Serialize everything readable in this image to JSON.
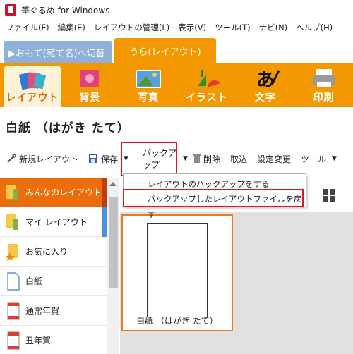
{
  "window": {
    "title": "筆ぐるめ for Windows"
  },
  "menu": [
    "ファイル(F)",
    "編集(E)",
    "レイアウトの管理(L)",
    "表示(V)",
    "ツール(T)",
    "ナビ(N)",
    "ヘルプ(H)"
  ],
  "view_tabs": {
    "front": "▶おもて(宛て名)へ切替",
    "back": "うら(レイアウト)"
  },
  "categories": [
    "レイアウト",
    "背景",
    "写真",
    "イラスト",
    "文字",
    "印刷"
  ],
  "doc_title": "白紙 （はがき たて）",
  "toolbar": {
    "new_layout": "新規レイアウト",
    "save": "保存",
    "backup": "バックアップ",
    "delete": "削除",
    "import": "取込",
    "settings_change": "設定変更",
    "tools": "ツール"
  },
  "dropdown": {
    "items": [
      "レイアウトのバックアップをする",
      "バックアップしたレイアウトファイルを戻す"
    ]
  },
  "left_list": [
    {
      "label": "みんなのレイアウト",
      "selected": true
    },
    {
      "label": "マイ レイアウト"
    },
    {
      "label": "お気に入り"
    },
    {
      "label": "白紙"
    },
    {
      "label": "通常年賀"
    },
    {
      "label": "丑年賀"
    }
  ],
  "thumbnail": {
    "label": "白紙 （はがき たて）"
  },
  "colors": {
    "accent": "#f39800",
    "selected": "#ed6d0a",
    "highlight_red": "#e6141e"
  }
}
